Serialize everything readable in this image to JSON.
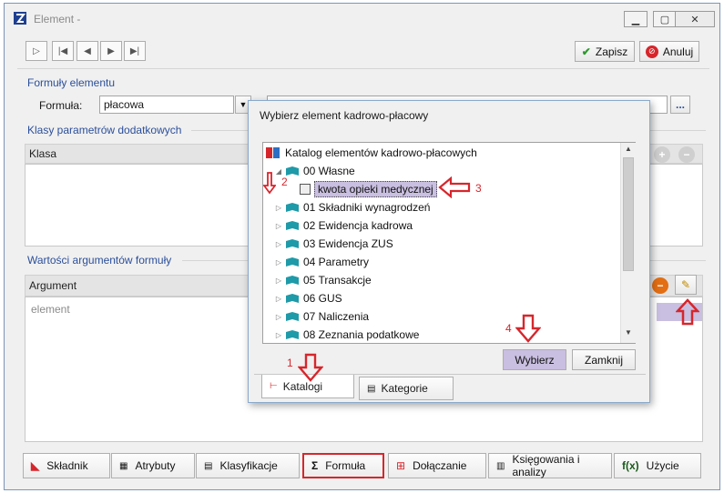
{
  "window": {
    "title": "Element -"
  },
  "toolbar": {
    "save_label": "Zapisz",
    "cancel_label": "Anuluj"
  },
  "formulas": {
    "section_title": "Formuły elementu",
    "formula_label": "Formuła:",
    "formula_value": "płacowa",
    "browse_label": "..."
  },
  "classes": {
    "section_title": "Klasy parametrów dodatkowych",
    "column": "Klasa"
  },
  "arguments": {
    "section_title": "Wartości argumentów formuły",
    "column": "Argument",
    "rows": [
      "element"
    ]
  },
  "tabs": [
    "Składnik",
    "Atrybuty",
    "Klasyfikacje",
    "Formuła",
    "Dołączanie",
    "Księgowania i analizy",
    "Użycie"
  ],
  "dialog": {
    "title": "Wybierz element kadrowo-płacowy",
    "root": "Katalog elementów kadrowo-płacowych",
    "items": [
      {
        "label": "00 Własne",
        "expanded": true
      },
      {
        "label": "kwota opieki medycznej",
        "child": true,
        "selected": true
      },
      {
        "label": "01 Składniki wynagrodzeń"
      },
      {
        "label": "02 Ewidencja kadrowa"
      },
      {
        "label": "03 Ewidencja ZUS"
      },
      {
        "label": "04 Parametry"
      },
      {
        "label": "05 Transakcje"
      },
      {
        "label": "06 GUS"
      },
      {
        "label": "07 Naliczenia"
      },
      {
        "label": "08 Zeznania podatkowe"
      }
    ],
    "select_label": "Wybierz",
    "close_label": "Zamknij",
    "tabs": [
      "Katalogi",
      "Kategorie"
    ]
  },
  "annotations": [
    "1",
    "2",
    "3",
    "4"
  ],
  "colors": {
    "accent_red": "#d6262c",
    "section_blue": "#2b4f9a",
    "selection": "#c9bfe0"
  }
}
